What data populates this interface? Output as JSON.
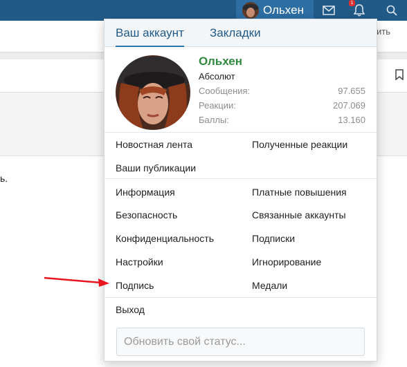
{
  "nav": {
    "user_name": "Ольхен",
    "badge": "1",
    "icons": [
      "mail-icon",
      "bell-icon",
      "search-icon"
    ],
    "colors": {
      "bar": "#225a87",
      "user_bg": "#2d6ea3"
    }
  },
  "background": {
    "right_fragment": "ить",
    "left_fragment": "ь."
  },
  "popup": {
    "tabs": [
      {
        "label": "Ваш аккаунт",
        "active": true
      },
      {
        "label": "Закладки",
        "active": false
      }
    ],
    "profile": {
      "name": "Ольхен",
      "title": "Абсолют",
      "stats": [
        {
          "label": "Сообщения:",
          "value": "97.655"
        },
        {
          "label": "Реакции:",
          "value": "207.069"
        },
        {
          "label": "Баллы:",
          "value": "13.160"
        }
      ],
      "name_color": "#2f8a3d"
    },
    "menu1": {
      "news_feed": "Новостная лента",
      "received_reactions": "Полученные реакции",
      "your_posts": "Ваши публикации"
    },
    "menu2": {
      "info": "Информация",
      "paid_upgrades": "Платные повышения",
      "security": "Безопасность",
      "linked_accounts": "Связанные аккаунты",
      "privacy": "Конфиденциальность",
      "subscriptions": "Подписки",
      "settings": "Настройки",
      "ignoring": "Игнорирование",
      "signature": "Подпись",
      "medals": "Медали"
    },
    "logout": "Выход",
    "status_placeholder": "Обновить свой статус..."
  }
}
